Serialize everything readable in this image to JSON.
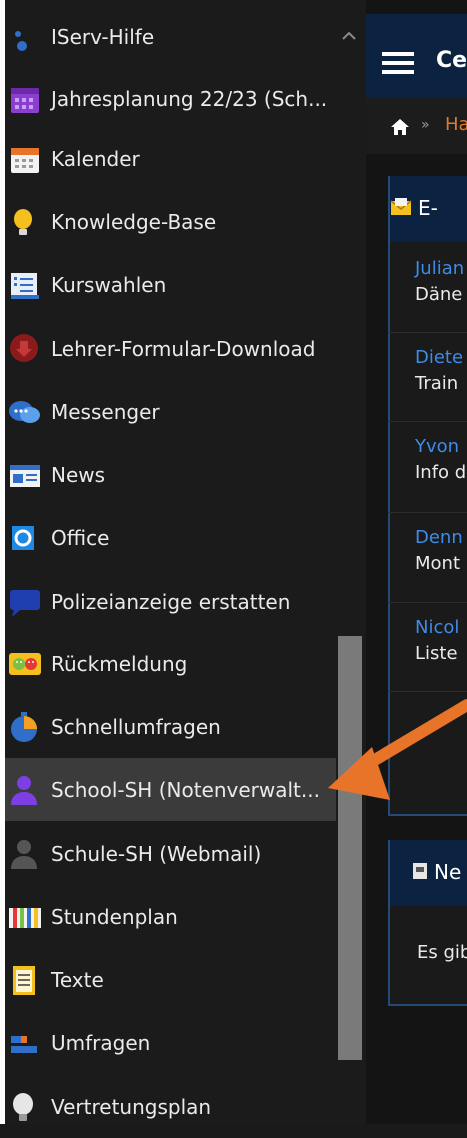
{
  "sidebar": {
    "items": [
      {
        "label": "IServ-Hilfe",
        "icon": "iserv-help-icon"
      },
      {
        "label": "Jahresplanung 22/23 (Sch...",
        "icon": "calendar-purple-icon"
      },
      {
        "label": "Kalender",
        "icon": "calendar-icon"
      },
      {
        "label": "Knowledge-Base",
        "icon": "lightbulb-icon"
      },
      {
        "label": "Kurswahlen",
        "icon": "course-choice-icon"
      },
      {
        "label": "Lehrer-Formular-Download",
        "icon": "download-icon"
      },
      {
        "label": "Messenger",
        "icon": "chat-bubbles-icon"
      },
      {
        "label": "News",
        "icon": "news-icon"
      },
      {
        "label": "Office",
        "icon": "office-icon"
      },
      {
        "label": "Polizeianzeige erstatten",
        "icon": "speech-bubble-icon"
      },
      {
        "label": "Rückmeldung",
        "icon": "feedback-faces-icon"
      },
      {
        "label": "Schnellumfragen",
        "icon": "stopwatch-icon"
      },
      {
        "label": "School-SH (Notenverwalt...",
        "icon": "user-purple-icon",
        "active": true
      },
      {
        "label": "Schule-SH (Webmail)",
        "icon": "user-grey-icon"
      },
      {
        "label": "Stundenplan",
        "icon": "timetable-icon"
      },
      {
        "label": "Texte",
        "icon": "document-icon"
      },
      {
        "label": "Umfragen",
        "icon": "bar-survey-icon"
      },
      {
        "label": "Vertretungsplan",
        "icon": "bulb-icon"
      }
    ]
  },
  "header": {
    "title": "Ces"
  },
  "breadcrumb": {
    "separator": "»",
    "link": "Ha"
  },
  "email_panel": {
    "title": "E-",
    "mails": [
      {
        "from": "Julian",
        "subject": "Däne"
      },
      {
        "from": "Diete",
        "subject": "Train"
      },
      {
        "from": "Yvon",
        "subject": "Info d"
      },
      {
        "from": "Denn",
        "subject": "Mont"
      },
      {
        "from": "Nicol",
        "subject": "Liste"
      }
    ]
  },
  "news_panel": {
    "title": "Ne",
    "text": "Es gib"
  },
  "colors": {
    "accent": "#0b2340",
    "link": "#3d8ce8",
    "annotation_arrow": "#e8742a",
    "active_item": "#3b3b3b"
  }
}
